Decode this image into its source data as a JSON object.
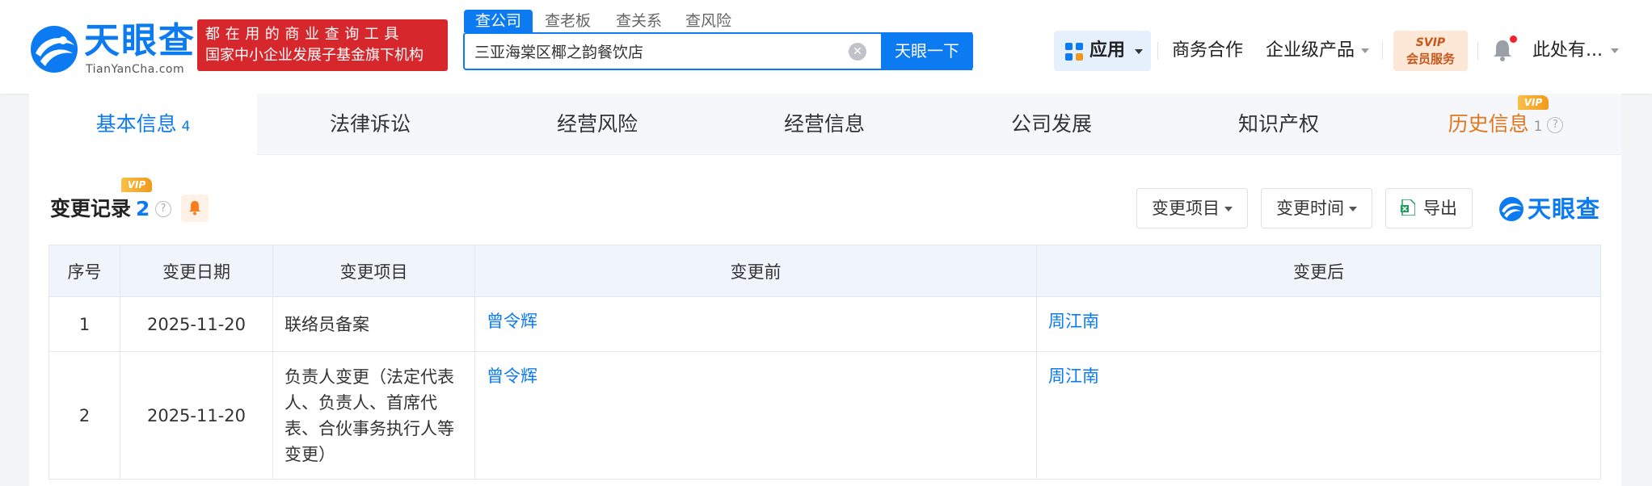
{
  "header": {
    "logo_cn": "天眼查",
    "logo_en": "TianYanCha.com",
    "slogan_line1": "都在用的商业查询工具",
    "slogan_line2": "国家中小企业发展子基金旗下机构",
    "search_tabs": [
      "查公司",
      "查老板",
      "查关系",
      "查风险"
    ],
    "search_value": "三亚海棠区椰之韵餐饮店",
    "search_button": "天眼一下",
    "apps_label": "应用",
    "nav_business": "商务合作",
    "nav_enterprise": "企业级产品",
    "svip_line1": "SVIP",
    "svip_line2": "会员服务",
    "user_name": "此处有..."
  },
  "tabs": [
    {
      "label": "基本信息",
      "count": "4"
    },
    {
      "label": "法律诉讼"
    },
    {
      "label": "经营风险"
    },
    {
      "label": "经营信息"
    },
    {
      "label": "公司发展"
    },
    {
      "label": "知识产权"
    },
    {
      "label": "历史信息",
      "count": "1"
    }
  ],
  "vip_badge": "VIP",
  "section": {
    "title": "变更记录",
    "count": "2",
    "filter_item": "变更项目",
    "filter_time": "变更时间",
    "export": "导出",
    "watermark": "天眼查"
  },
  "table": {
    "headers": [
      "序号",
      "变更日期",
      "变更项目",
      "变更前",
      "变更后"
    ],
    "rows": [
      {
        "no": "1",
        "date": "2025-11-20",
        "item": "联络员备案",
        "before": "曾令辉",
        "after": "周江南"
      },
      {
        "no": "2",
        "date": "2025-11-20",
        "item": "负责人变更（法定代表人、负责人、首席代表、合伙事务执行人等变更）",
        "before": "曾令辉",
        "after": "周江南"
      }
    ]
  },
  "colors": {
    "brand": "#0c7bf2",
    "slogan_bg": "#d6272c",
    "history_tab": "#e2761a",
    "vip": "#f09a1b"
  }
}
